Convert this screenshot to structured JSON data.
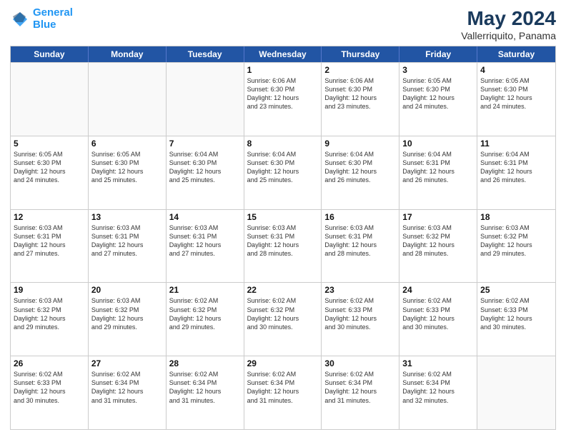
{
  "header": {
    "logo_line1": "General",
    "logo_line2": "Blue",
    "month_year": "May 2024",
    "location": "Vallerriquito, Panama"
  },
  "weekdays": [
    "Sunday",
    "Monday",
    "Tuesday",
    "Wednesday",
    "Thursday",
    "Friday",
    "Saturday"
  ],
  "rows": [
    [
      {
        "day": "",
        "info": "",
        "empty": true
      },
      {
        "day": "",
        "info": "",
        "empty": true
      },
      {
        "day": "",
        "info": "",
        "empty": true
      },
      {
        "day": "1",
        "info": "Sunrise: 6:06 AM\nSunset: 6:30 PM\nDaylight: 12 hours\nand 23 minutes."
      },
      {
        "day": "2",
        "info": "Sunrise: 6:06 AM\nSunset: 6:30 PM\nDaylight: 12 hours\nand 23 minutes."
      },
      {
        "day": "3",
        "info": "Sunrise: 6:05 AM\nSunset: 6:30 PM\nDaylight: 12 hours\nand 24 minutes."
      },
      {
        "day": "4",
        "info": "Sunrise: 6:05 AM\nSunset: 6:30 PM\nDaylight: 12 hours\nand 24 minutes."
      }
    ],
    [
      {
        "day": "5",
        "info": "Sunrise: 6:05 AM\nSunset: 6:30 PM\nDaylight: 12 hours\nand 24 minutes."
      },
      {
        "day": "6",
        "info": "Sunrise: 6:05 AM\nSunset: 6:30 PM\nDaylight: 12 hours\nand 25 minutes."
      },
      {
        "day": "7",
        "info": "Sunrise: 6:04 AM\nSunset: 6:30 PM\nDaylight: 12 hours\nand 25 minutes."
      },
      {
        "day": "8",
        "info": "Sunrise: 6:04 AM\nSunset: 6:30 PM\nDaylight: 12 hours\nand 25 minutes."
      },
      {
        "day": "9",
        "info": "Sunrise: 6:04 AM\nSunset: 6:30 PM\nDaylight: 12 hours\nand 26 minutes."
      },
      {
        "day": "10",
        "info": "Sunrise: 6:04 AM\nSunset: 6:31 PM\nDaylight: 12 hours\nand 26 minutes."
      },
      {
        "day": "11",
        "info": "Sunrise: 6:04 AM\nSunset: 6:31 PM\nDaylight: 12 hours\nand 26 minutes."
      }
    ],
    [
      {
        "day": "12",
        "info": "Sunrise: 6:03 AM\nSunset: 6:31 PM\nDaylight: 12 hours\nand 27 minutes."
      },
      {
        "day": "13",
        "info": "Sunrise: 6:03 AM\nSunset: 6:31 PM\nDaylight: 12 hours\nand 27 minutes."
      },
      {
        "day": "14",
        "info": "Sunrise: 6:03 AM\nSunset: 6:31 PM\nDaylight: 12 hours\nand 27 minutes."
      },
      {
        "day": "15",
        "info": "Sunrise: 6:03 AM\nSunset: 6:31 PM\nDaylight: 12 hours\nand 28 minutes."
      },
      {
        "day": "16",
        "info": "Sunrise: 6:03 AM\nSunset: 6:31 PM\nDaylight: 12 hours\nand 28 minutes."
      },
      {
        "day": "17",
        "info": "Sunrise: 6:03 AM\nSunset: 6:32 PM\nDaylight: 12 hours\nand 28 minutes."
      },
      {
        "day": "18",
        "info": "Sunrise: 6:03 AM\nSunset: 6:32 PM\nDaylight: 12 hours\nand 29 minutes."
      }
    ],
    [
      {
        "day": "19",
        "info": "Sunrise: 6:03 AM\nSunset: 6:32 PM\nDaylight: 12 hours\nand 29 minutes."
      },
      {
        "day": "20",
        "info": "Sunrise: 6:03 AM\nSunset: 6:32 PM\nDaylight: 12 hours\nand 29 minutes."
      },
      {
        "day": "21",
        "info": "Sunrise: 6:02 AM\nSunset: 6:32 PM\nDaylight: 12 hours\nand 29 minutes."
      },
      {
        "day": "22",
        "info": "Sunrise: 6:02 AM\nSunset: 6:32 PM\nDaylight: 12 hours\nand 30 minutes."
      },
      {
        "day": "23",
        "info": "Sunrise: 6:02 AM\nSunset: 6:33 PM\nDaylight: 12 hours\nand 30 minutes."
      },
      {
        "day": "24",
        "info": "Sunrise: 6:02 AM\nSunset: 6:33 PM\nDaylight: 12 hours\nand 30 minutes."
      },
      {
        "day": "25",
        "info": "Sunrise: 6:02 AM\nSunset: 6:33 PM\nDaylight: 12 hours\nand 30 minutes."
      }
    ],
    [
      {
        "day": "26",
        "info": "Sunrise: 6:02 AM\nSunset: 6:33 PM\nDaylight: 12 hours\nand 30 minutes."
      },
      {
        "day": "27",
        "info": "Sunrise: 6:02 AM\nSunset: 6:34 PM\nDaylight: 12 hours\nand 31 minutes."
      },
      {
        "day": "28",
        "info": "Sunrise: 6:02 AM\nSunset: 6:34 PM\nDaylight: 12 hours\nand 31 minutes."
      },
      {
        "day": "29",
        "info": "Sunrise: 6:02 AM\nSunset: 6:34 PM\nDaylight: 12 hours\nand 31 minutes."
      },
      {
        "day": "30",
        "info": "Sunrise: 6:02 AM\nSunset: 6:34 PM\nDaylight: 12 hours\nand 31 minutes."
      },
      {
        "day": "31",
        "info": "Sunrise: 6:02 AM\nSunset: 6:34 PM\nDaylight: 12 hours\nand 32 minutes."
      },
      {
        "day": "",
        "info": "",
        "empty": true
      }
    ]
  ]
}
